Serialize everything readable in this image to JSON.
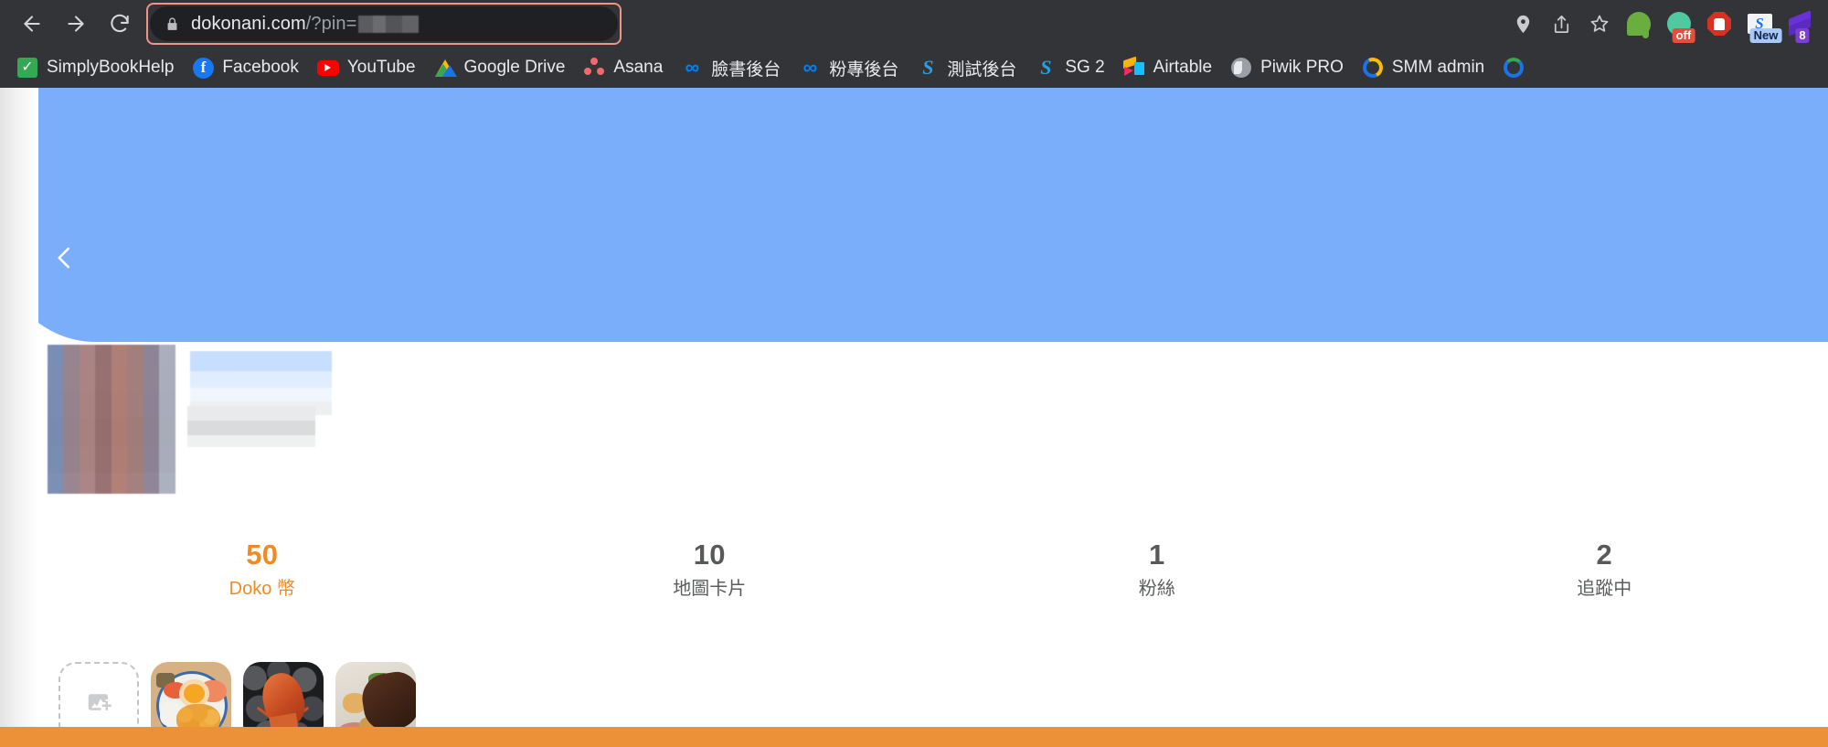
{
  "browser": {
    "nav": {
      "back_label": "Back",
      "forward_label": "Forward",
      "reload_label": "Reload"
    },
    "omnibox": {
      "lock_icon": "lock-icon",
      "url_domain": "dokonani.com",
      "url_path": "/?pin=",
      "url_redacted_value": "",
      "highlighted": true,
      "highlight_color": "#f0938a"
    },
    "toolbar_icons": [
      {
        "name": "location-icon",
        "label": "Location"
      },
      {
        "name": "share-icon",
        "label": "Share"
      },
      {
        "name": "bookmark-star-icon",
        "label": "Bookmark this tab"
      }
    ],
    "extensions": [
      {
        "name": "evernote-extension-icon",
        "label": "Evernote Web Clipper",
        "badge": ""
      },
      {
        "name": "green-circle-extension-icon",
        "label": "Extension",
        "badge": "off"
      },
      {
        "name": "adblock-extension-icon",
        "label": "AdBlock",
        "badge": ""
      },
      {
        "name": "s-extension-icon",
        "label": "Extension",
        "badge": "New"
      },
      {
        "name": "purple-diamond-extension-icon",
        "label": "Extension",
        "badge": "8"
      }
    ],
    "bookmarks": [
      {
        "label": "SimplyBookHelp",
        "icon": "green-check-icon"
      },
      {
        "label": "Facebook",
        "icon": "facebook-icon"
      },
      {
        "label": "YouTube",
        "icon": "youtube-icon"
      },
      {
        "label": "Google Drive",
        "icon": "google-drive-icon"
      },
      {
        "label": "Asana",
        "icon": "asana-icon"
      },
      {
        "label": "臉書後台",
        "icon": "meta-icon"
      },
      {
        "label": "粉專後台",
        "icon": "meta-icon"
      },
      {
        "label": "測試後台",
        "icon": "simplybook-icon"
      },
      {
        "label": "SG 2",
        "icon": "simplybook-icon"
      },
      {
        "label": "Airtable",
        "icon": "airtable-icon"
      },
      {
        "label": "Piwik PRO",
        "icon": "piwik-pro-icon"
      },
      {
        "label": "SMM admin",
        "icon": "smm-icon"
      }
    ]
  },
  "page": {
    "hero": {
      "background_color": "#7aaefa",
      "back_button_label": "返回",
      "avatar_redacted": true,
      "username_redacted": true
    },
    "stats": [
      {
        "value": "50",
        "label": "Doko 幣",
        "accent": true,
        "accent_color": "#ef8b25"
      },
      {
        "value": "10",
        "label": "地圖卡片",
        "accent": false
      },
      {
        "value": "1",
        "label": "粉絲",
        "accent": false
      },
      {
        "value": "2",
        "label": "追蹤中",
        "accent": false
      }
    ],
    "gallery": [
      {
        "type": "add",
        "label": "新增圖片",
        "icon": "add-image-icon"
      },
      {
        "type": "photo",
        "label": "海膽鮭魚丼飯"
      },
      {
        "type": "photo",
        "label": "龍蝦石板料理"
      },
      {
        "type": "photo",
        "label": "牛排佐馬鈴薯"
      }
    ],
    "bottom_bar_color": "#ed9138"
  }
}
